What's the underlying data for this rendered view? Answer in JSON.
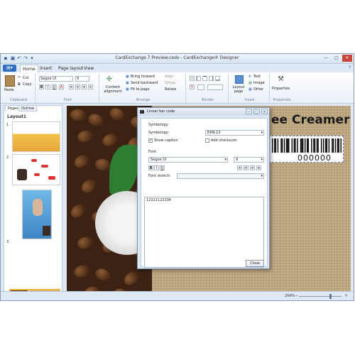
{
  "window": {
    "title": "CardExchange 7 Preview.cedx - CardExchange® Designer"
  },
  "menu": {
    "file_label": "",
    "tabs": [
      "Home",
      "Insert",
      "Page layout",
      "View"
    ]
  },
  "ribbon": {
    "clipboard": {
      "paste": "Paste",
      "cut": "Cut",
      "copy": "Copy",
      "label": "Clipboard"
    },
    "font": {
      "family": "Segoe UI",
      "size": "9",
      "bold": "B",
      "italic": "I",
      "underline": "U",
      "label": "Font"
    },
    "arrange": {
      "content_alignment": "Content alignment",
      "bring_forward": "Bring forward",
      "send_backward": "Send backward",
      "fit_to_page": "Fit to page",
      "align": "Align",
      "group": "Group",
      "rotate": "Rotate",
      "label": "Arrange"
    },
    "border": {
      "label": "Border"
    },
    "insert": {
      "layout_page": "Layout page",
      "text": "Text",
      "image": "Image",
      "other": "Other",
      "label": "Insert"
    },
    "properties": {
      "properties": "Properties",
      "label": "Properties"
    }
  },
  "left_panel": {
    "tabs": [
      "Pages",
      "Outline"
    ],
    "layout_label": "Layout1",
    "pages": [
      "1",
      "2",
      "3",
      "4"
    ]
  },
  "canvas": {
    "title": "ee Creamer",
    "barcode_number": "000000"
  },
  "dialog": {
    "title": "Linear bar code",
    "symbology_section": "Symbology",
    "symbology_label": "Symbology:",
    "symbology_value": "EAN-13",
    "show_caption": "Show caption",
    "add_checksum": "Add checksum",
    "font_section": "Font",
    "font_family": "Segoe UI",
    "font_size": "9",
    "bold": "B",
    "italic": "I",
    "underline": "U",
    "font_stretch_label": "Font stretch:",
    "barcode_value": "12221122334",
    "close_label": "Close"
  },
  "status": {
    "zoom": "294%",
    "zoom_fraction": 0.74
  },
  "colors": {
    "accent": "#2f6fc0",
    "window_bg": "#dfe9f5",
    "burlap": "#c8b088",
    "beans": "#3b2213"
  }
}
